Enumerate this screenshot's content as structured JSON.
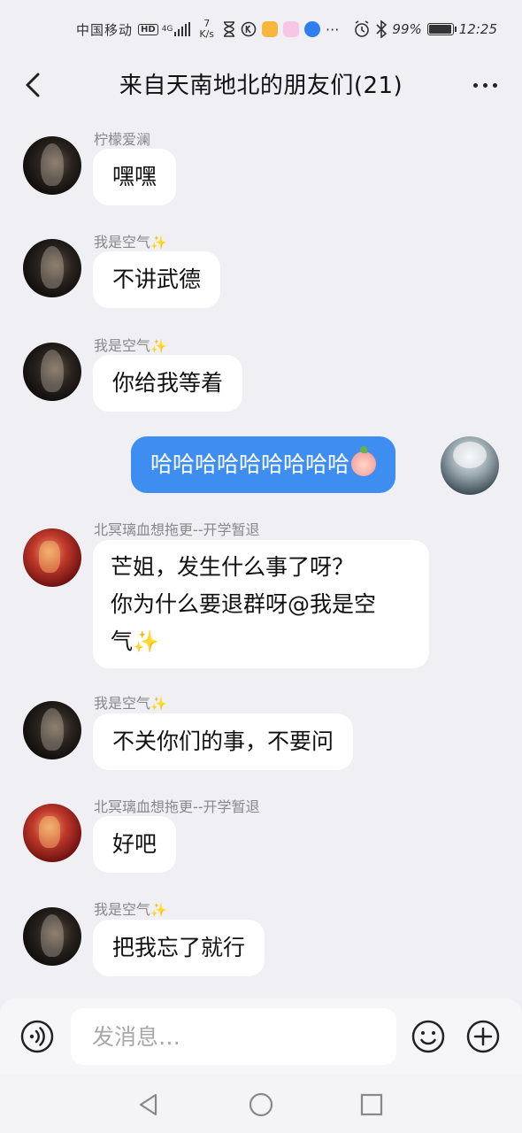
{
  "status_bar": {
    "carrier": "中国移动",
    "hd": "HD",
    "network": "4G",
    "speed_value": "7",
    "speed_unit": "K/s",
    "battery_percent": "99%",
    "time": "12:25"
  },
  "header": {
    "title": "来自天南地北的朋友们(21)"
  },
  "messages": [
    {
      "sender": "柠檬爱澜",
      "text": "嘿嘿",
      "avatar": "dark"
    },
    {
      "sender": "我是空气",
      "sparkle": "✨",
      "text": "不讲武德",
      "avatar": "dark"
    },
    {
      "sender": "我是空气",
      "sparkle": "✨",
      "text": "你给我等着",
      "avatar": "dark"
    },
    {
      "sender": "",
      "text": "哈哈哈哈哈哈哈哈哈",
      "avatar": "self",
      "emoji": "peach-emoji"
    },
    {
      "sender": "北冥璃血想拖更--开学暂退",
      "line1": "芒姐，发生什么事了呀？",
      "line2": "你为什么要退群呀@我是空",
      "line3": "气",
      "line3_sparkle": "✨",
      "avatar": "red"
    },
    {
      "sender": "我是空气",
      "sparkle": "✨",
      "text": "不关你们的事，不要问",
      "avatar": "dark"
    },
    {
      "sender": "北冥璃血想拖更--开学暂退",
      "text": "好吧",
      "avatar": "red"
    },
    {
      "sender": "我是空气",
      "sparkle": "✨",
      "text": "把我忘了就行",
      "avatar": "dark"
    }
  ],
  "input_bar": {
    "placeholder": "发消息…",
    "voice_icon": "voice-icon",
    "emoji_icon": "smiley-icon",
    "plus_icon": "plus-icon"
  },
  "colors": {
    "background": "#efeff4",
    "own_bubble": "#3d8ef0",
    "other_bubble": "#ffffff",
    "sender_name": "#888888",
    "sparkle": "#f2c94c"
  }
}
